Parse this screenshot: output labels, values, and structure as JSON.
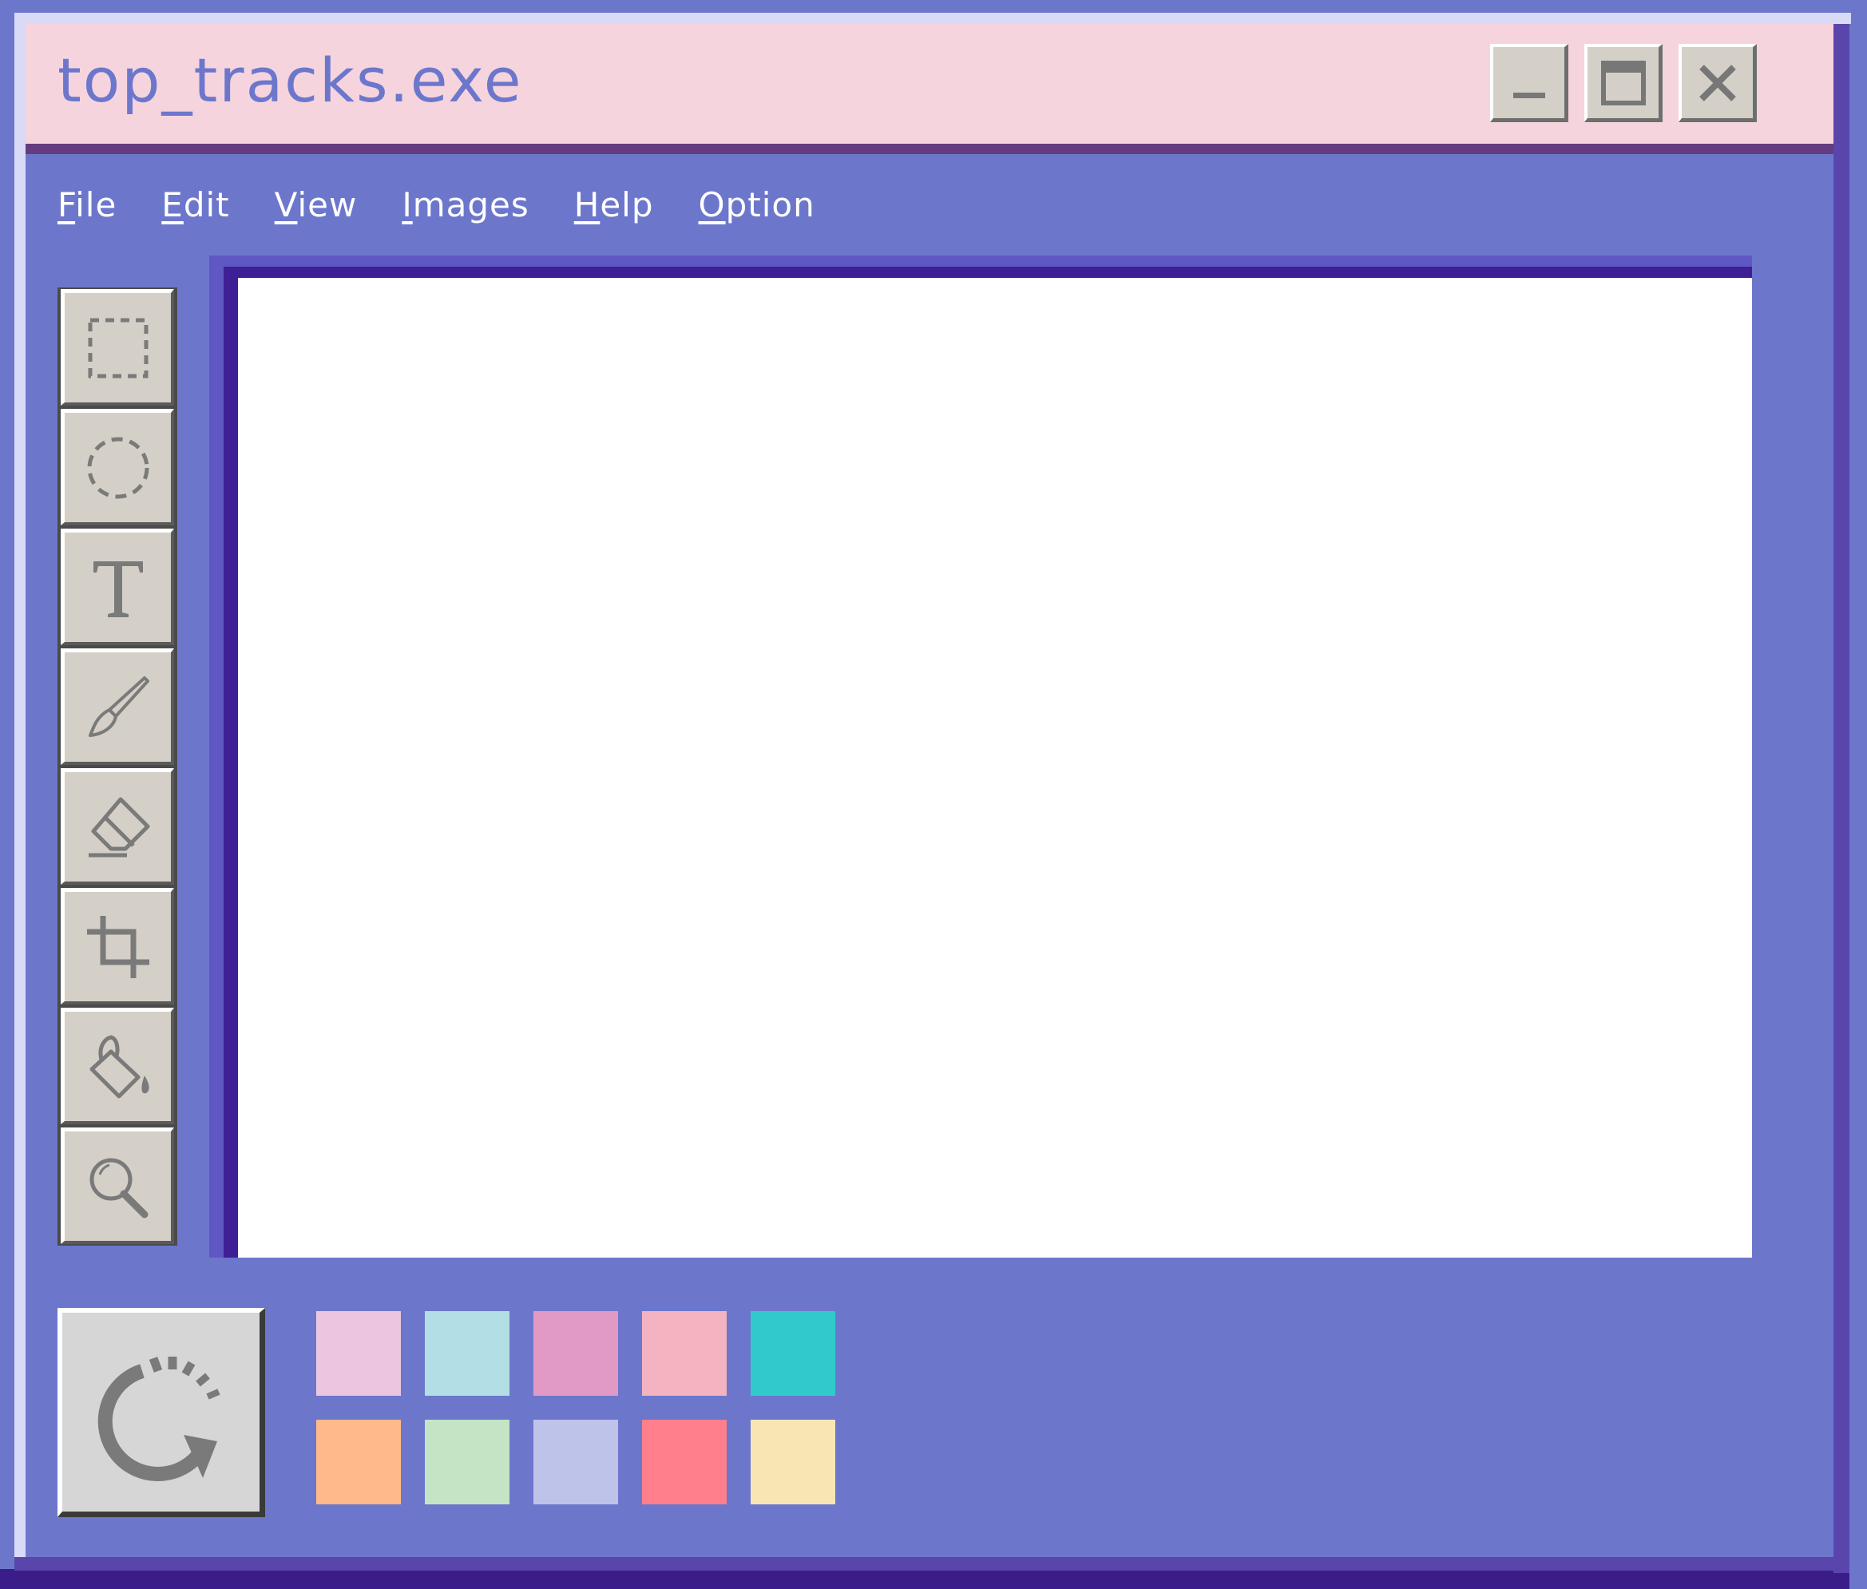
{
  "window": {
    "title": "top_tracks.exe",
    "controls": {
      "minimize": "minimize-icon",
      "maximize": "maximize-icon",
      "close": "close-icon"
    }
  },
  "menu": [
    {
      "label": "File",
      "accel": "F",
      "rest": "ile"
    },
    {
      "label": "Edit",
      "accel": "E",
      "rest": "dit"
    },
    {
      "label": "View",
      "accel": "V",
      "rest": "iew"
    },
    {
      "label": "Images",
      "accel": "I",
      "rest": "mages"
    },
    {
      "label": "Help",
      "accel": "H",
      "rest": "elp"
    },
    {
      "label": "Option",
      "accel": "O",
      "rest": "ption"
    }
  ],
  "tools": [
    {
      "name": "rect-select",
      "icon": "dashed-square-icon"
    },
    {
      "name": "ellipse-select",
      "icon": "dashed-circle-icon"
    },
    {
      "name": "text",
      "icon": "text-t-icon"
    },
    {
      "name": "brush",
      "icon": "brush-icon"
    },
    {
      "name": "eraser",
      "icon": "eraser-icon"
    },
    {
      "name": "crop",
      "icon": "crop-icon"
    },
    {
      "name": "fill",
      "icon": "paint-bucket-icon"
    },
    {
      "name": "zoom",
      "icon": "magnifier-icon"
    }
  ],
  "reset": {
    "icon": "rotate-refresh-icon"
  },
  "palette": [
    [
      "#ecc6e0",
      "#b2dfe5",
      "#e09ac5",
      "#f4b3c0",
      "#30cacd"
    ],
    [
      "#ffb98a",
      "#c3e5c6",
      "#bec3e9",
      "#ff7f8c",
      "#f7e6b4"
    ]
  ],
  "colors": {
    "frame": "#6c77cc",
    "titlebar": "#f6d4de",
    "title_text": "#6c77cc",
    "canvas": "#ffffff",
    "button_face": "#d4d0c8"
  }
}
